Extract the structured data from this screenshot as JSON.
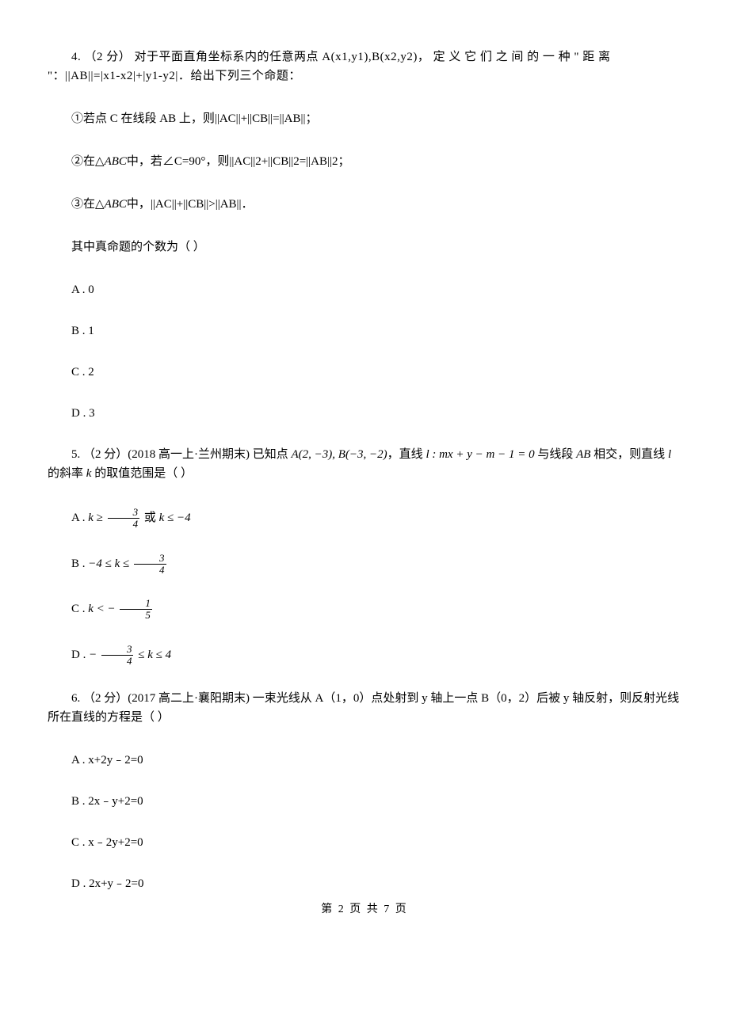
{
  "q4": {
    "line1": "4. （2 分）  对于平面直角坐标系内的任意两点 A(x1,y1),B(x2,y2)， 定 义 它 们 之 间 的 一 种 \" 距 离 \"：||AB||=|x1-x2|+|y1-y2|．给出下列三个命题：",
    "line2": "①若点 C 在线段 AB 上，则||AC||+||CB||=||AB||；",
    "line3_pre": "②在",
    "line3_tri": "△ABC",
    "line3_post": "中，若∠C=90°，则||AC||2+||CB||2=||AB||2；",
    "line4_pre": "③在",
    "line4_tri": "△ABC",
    "line4_post": "中，||AC||+||CB||>||AB||．",
    "stem2": "其中真命题的个数为（    ）",
    "optA": "A . 0",
    "optB": "B . 1",
    "optC": "C . 2",
    "optD": "D . 3"
  },
  "q5": {
    "stem_pre": "5. （2 分）(2018 高一上·兰州期末) 已知点 ",
    "pointA": "A(2, −3), B(−3, −2)",
    "stem_mid": "，直线 ",
    "line_l": "l : mx + y − m − 1 = 0",
    "stem_post": " 与线段 ",
    "seg": "AB",
    "stem_end": " 相交，则直线 ",
    "l_char": "l",
    "stem_end2": " 的斜率 ",
    "k_char": "k",
    "stem_end3": " 的取值范围是（    ）",
    "optA_pre": "A . ",
    "optA_math1": "k ≥ ",
    "optA_frac_n": "3",
    "optA_frac_d": "4",
    "optA_or": " 或 ",
    "optA_math2": "k ≤ −4",
    "optB_pre": "B . ",
    "optB_math1": "−4 ≤ k ≤ ",
    "optB_frac_n": "3",
    "optB_frac_d": "4",
    "optC_pre": "C . ",
    "optC_math": "k < − ",
    "optC_frac_n": "1",
    "optC_frac_d": "5",
    "optD_pre": "D . ",
    "optD_math1": "− ",
    "optD_frac_n": "3",
    "optD_frac_d": "4",
    "optD_math2": " ≤ k ≤ 4"
  },
  "q6": {
    "stem": "6. （2 分）(2017 高二上·襄阳期末) 一束光线从 A（1，0）点处射到 y 轴上一点 B（0，2）后被 y 轴反射，则反射光线所在直线的方程是（    ）",
    "optA": "A .  x+2y﹣2=0",
    "optB": "B .  2x﹣y+2=0",
    "optC": "C .  x﹣2y+2=0",
    "optD": "D .  2x+y﹣2=0"
  },
  "footer": "第 2 页 共 7 页"
}
